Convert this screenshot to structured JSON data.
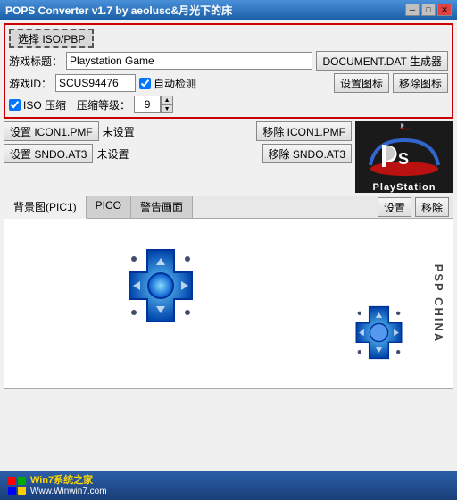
{
  "titleBar": {
    "text": "POPS Converter v1.7 by aeolusc&月光下的床",
    "minBtn": "─",
    "maxBtn": "□",
    "closeBtn": "✕"
  },
  "topSection": {
    "selectIsoBtn": "选择 ISO/PBP",
    "gameTitleLabel": "游戏标题：",
    "gameTitleValue": "Playstation Game",
    "documentDatBtn": "DOCUMENT.DAT 生成器",
    "gameIdLabel": "游戏ID：",
    "gameIdValue": "SCUS94476",
    "autoDetectLabel": "自动检测",
    "setIconBtn": "设置图标",
    "removeIconBtn": "移除图标",
    "isoCompressLabel": "ISO 压缩",
    "compressLevelLabel": "压缩等级：",
    "compressLevelValue": "9"
  },
  "middleSection": {
    "setIcon1Btn": "设置 ICON1.PMF",
    "icon1Status": "未设置",
    "removeIcon1Btn": "移除 ICON1.PMF",
    "setSndBtn": "设置 SNDO.AT3",
    "sndStatus": "未设置",
    "removeSndBtn": "移除 SNDO.AT3",
    "psLogoText": "PlayStation"
  },
  "bottomSection": {
    "tab1": "背景图(PIC1)",
    "tab2": "PICO",
    "tab3": "警告画面",
    "setBtn": "设置",
    "removeBtn": "移除",
    "pspChina": "PSP CHINA"
  },
  "win7Bar": {
    "line1": "Win7系统之家",
    "line2": "Www.Winwin7.com"
  }
}
